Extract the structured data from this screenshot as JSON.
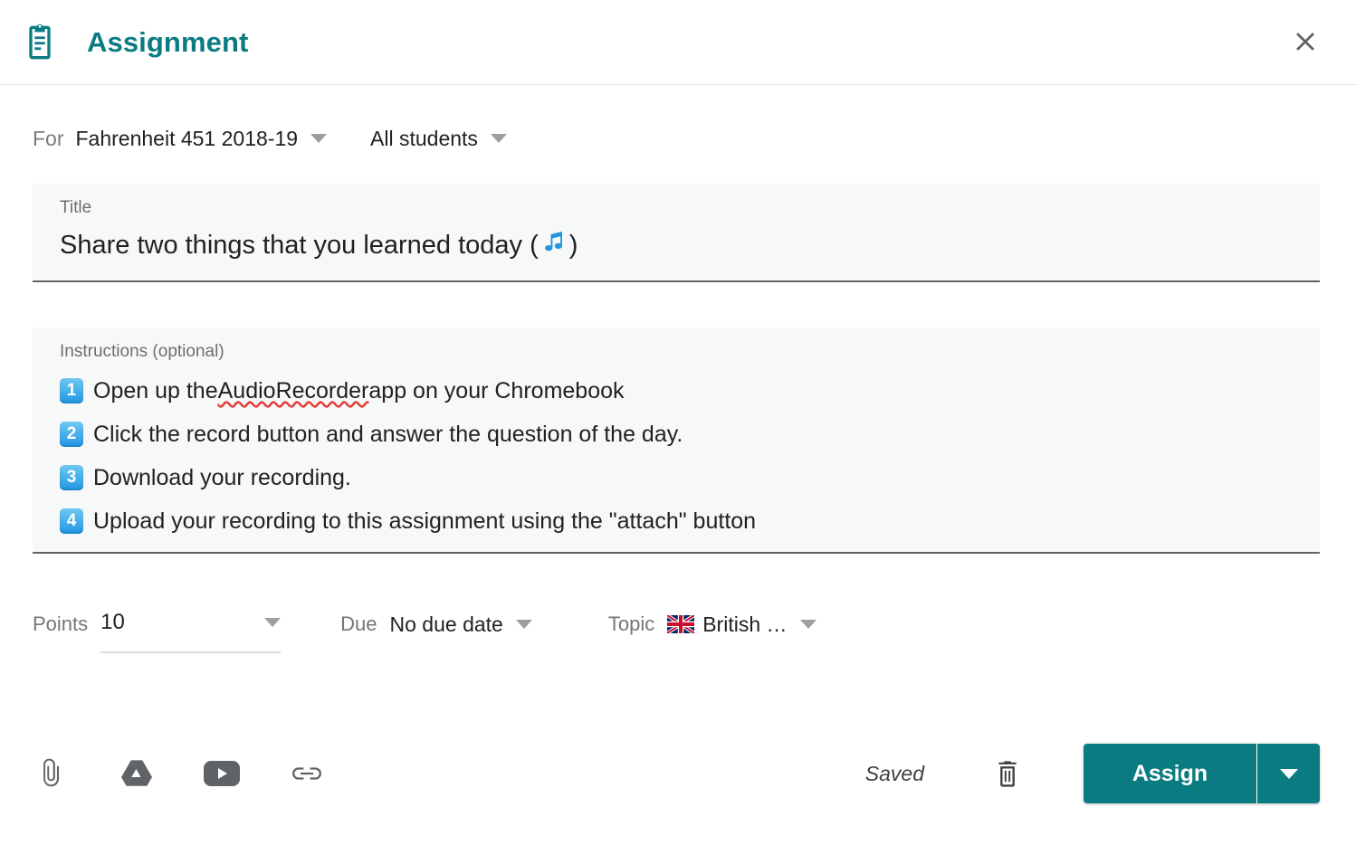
{
  "header": {
    "icon": "clipboard-icon",
    "title": "Assignment",
    "close_icon": "close-icon",
    "accent_color": "#0a7b81"
  },
  "audience": {
    "for_label": "For",
    "course": "Fahrenheit 451 2018-19",
    "students": "All students"
  },
  "title_field": {
    "label": "Title",
    "value_before": "Share two things that you learned today (",
    "emoji": "🎶",
    "value_after": ")"
  },
  "instructions_field": {
    "label": "Instructions (optional)",
    "lines": [
      {
        "num": "1",
        "before": "Open up the ",
        "misspelled": "AudioRecorder",
        "after": " app on your Chromebook"
      },
      {
        "num": "2",
        "before": "Click the record button and answer the question of the day.",
        "misspelled": "",
        "after": ""
      },
      {
        "num": "3",
        "before": "Download your recording.",
        "misspelled": "",
        "after": ""
      },
      {
        "num": "4",
        "before": "Upload your recording to this assignment using the \"attach\" button",
        "misspelled": "",
        "after": ""
      }
    ]
  },
  "meta": {
    "points_label": "Points",
    "points_value": "10",
    "due_label": "Due",
    "due_value": "No due date",
    "topic_label": "Topic",
    "topic_flag": "🇬🇧",
    "topic_value": "British …"
  },
  "toolbar": {
    "attach_icon": "paperclip-icon",
    "drive_icon": "google-drive-icon",
    "youtube_icon": "youtube-icon",
    "link_icon": "link-icon",
    "status": "Saved",
    "delete_icon": "trash-icon",
    "assign_label": "Assign",
    "assign_more_icon": "chevron-down-icon"
  }
}
